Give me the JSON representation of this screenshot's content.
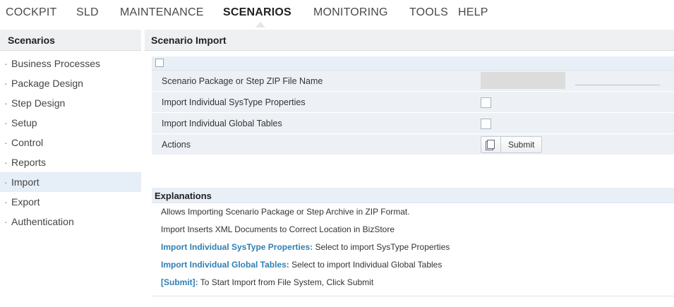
{
  "topnav": {
    "items": [
      {
        "label": "COCKPIT"
      },
      {
        "label": "SLD"
      },
      {
        "label": "MAINTENANCE"
      },
      {
        "label": "SCENARIOS",
        "active": true
      },
      {
        "label": "MONITORING"
      },
      {
        "label": "TOOLS"
      },
      {
        "label": "HELP"
      }
    ]
  },
  "sidebar": {
    "title": "Scenarios",
    "items": [
      {
        "label": "Business Processes"
      },
      {
        "label": "Package Design"
      },
      {
        "label": "Step Design"
      },
      {
        "label": "Setup"
      },
      {
        "label": "Control"
      },
      {
        "label": "Reports"
      },
      {
        "label": "Import",
        "active": true
      },
      {
        "label": "Export"
      },
      {
        "label": "Authentication"
      }
    ]
  },
  "main": {
    "title": "Scenario Import",
    "form": {
      "zip_label": "Scenario Package or Step ZIP File Name",
      "systype_label": "Import Individual SysType Properties",
      "global_label": "Import Individual Global Tables",
      "actions_label": "Actions",
      "submit_label": "Submit"
    },
    "explanations": {
      "title": "Explanations",
      "line1": "Allows Importing Scenario Package or Step Archive in ZIP Format.",
      "line2": "Import Inserts XML Documents to Correct Location in BizStore",
      "line3_kw": "Import Individual SysType Properties:",
      "line3_text": " Select to import SysType Properties",
      "line4_kw": "Import Individual Global Tables:",
      "line4_text": " Select to import Individual Global Tables",
      "line5_kw": "[Submit]:",
      "line5_text": " To Start Import from File System, Click Submit"
    }
  },
  "colors": {
    "accent_link": "#2f7fb5",
    "panel_header_bg": "#eef0f2",
    "row_bg": "#edf1f6",
    "active_item_bg": "#e6eef7"
  },
  "icons": {
    "collapse": "collapse-square-icon",
    "file_browse": "copy-pages-icon"
  }
}
